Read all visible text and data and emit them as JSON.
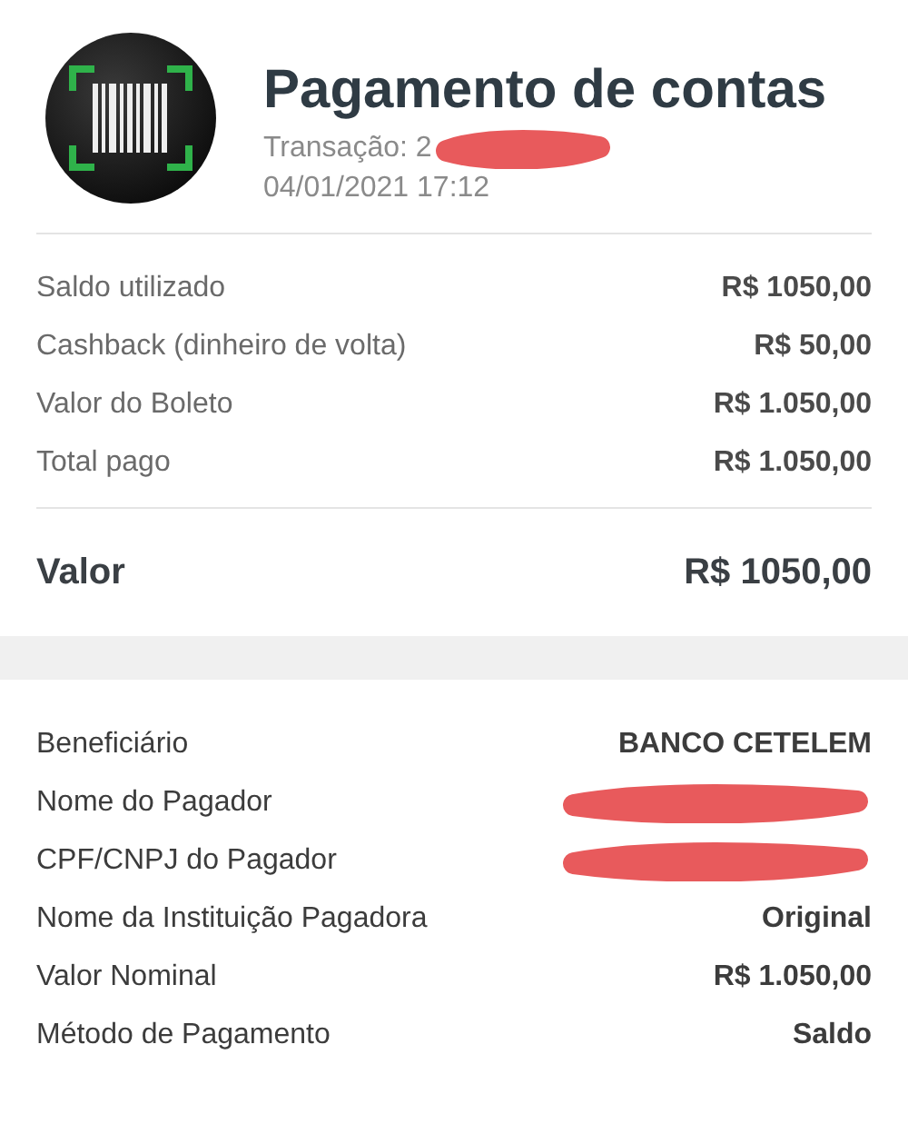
{
  "header": {
    "title": "Pagamento de contas",
    "transaction": "Transação: 2",
    "transaction_redacted": true,
    "datetime": "04/01/2021 17:12"
  },
  "summary": [
    {
      "label": "Saldo utilizado",
      "value": "R$ 1050,00"
    },
    {
      "label": "Cashback (dinheiro de volta)",
      "value": "R$ 50,00"
    },
    {
      "label": "Valor do Boleto",
      "value": "R$ 1.050,00"
    },
    {
      "label": "Total pago",
      "value": "R$ 1.050,00"
    }
  ],
  "total": {
    "label": "Valor",
    "value": "R$ 1050,00"
  },
  "details": [
    {
      "label": "Beneficiário",
      "value": "BANCO CETELEM",
      "redacted": false
    },
    {
      "label": "Nome do Pagador",
      "redacted": true
    },
    {
      "label": "CPF/CNPJ do Pagador",
      "redacted": true
    },
    {
      "label": "Nome da Instituição Pagadora",
      "value": "Original",
      "redacted": false
    },
    {
      "label": "Valor Nominal",
      "value": "R$ 1.050,00",
      "redacted": false
    },
    {
      "label": "Método de Pagamento",
      "value": "Saldo",
      "redacted": false
    }
  ]
}
